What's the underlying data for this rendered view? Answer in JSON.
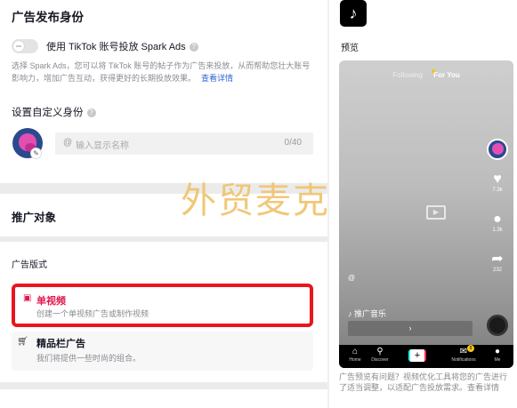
{
  "identity": {
    "title": "广告发布身份",
    "spark_label": "使用 TikTok 账号投放 Spark Ads",
    "spark_desc": "选择 Spark Ads，您可以将 TikTok 账号的帖子作为广告来投放，从而帮助您壮大账号影响力，增加广告互动，获得更好的长期投放效果。",
    "learn_more": "查看详情",
    "custom_title": "设置自定义身份",
    "name_placeholder": "输入显示名称",
    "name_count": "0/40"
  },
  "promotion": {
    "title": "推广对象"
  },
  "ad_format": {
    "label": "广告版式",
    "options": [
      {
        "title": "单视频",
        "subtitle": "创建一个单视频广告或制作视频",
        "selected": true
      },
      {
        "title": "精品栏广告",
        "subtitle": "我们将提供一些时尚的组合。"
      }
    ]
  },
  "preview": {
    "label": "预览",
    "tabs": [
      "Following",
      "For You"
    ],
    "likes": "7.3k",
    "comments": "1.3k",
    "shares": "232",
    "at_symbol": "@",
    "music": "♪ 推广音乐",
    "cta": "›",
    "nav": [
      "Home",
      "Discover",
      "Notifications",
      "Me"
    ],
    "notif_count": "9",
    "feedback": "广告预览有问题？视频优化工具将您的广告进行了适当调整，以适配广告投放需求。查看详情"
  },
  "watermark": "外贸麦克",
  "colors": {
    "accent": "#e0184d",
    "highlight_border": "#e8161d",
    "link": "#2f65d6"
  }
}
